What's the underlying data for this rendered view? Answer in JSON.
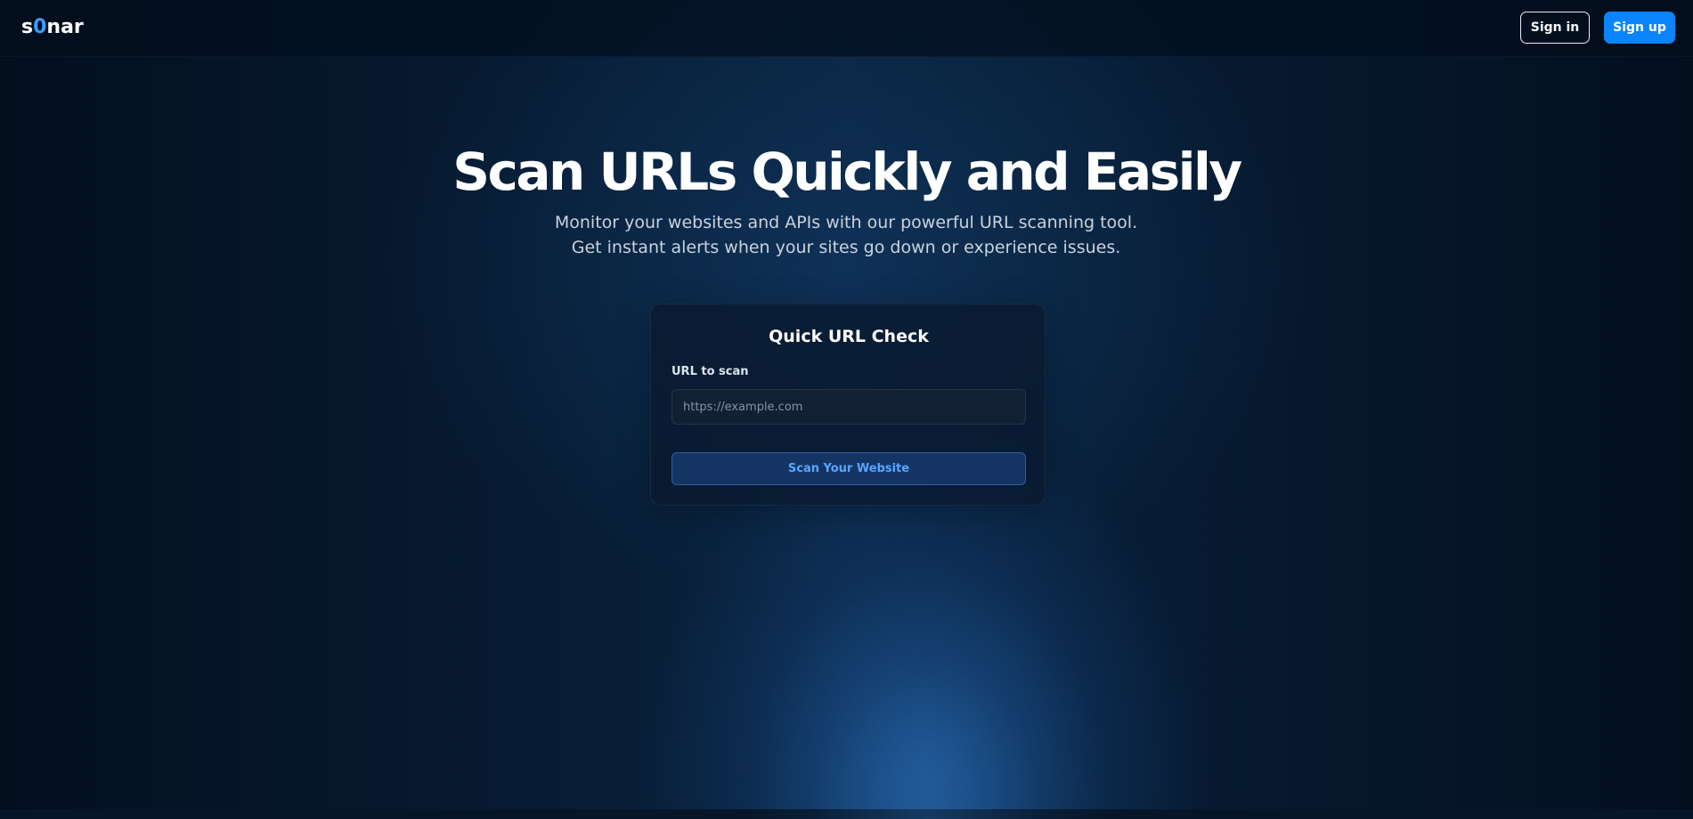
{
  "header": {
    "logo_prefix": "s",
    "logo_accent": "0",
    "logo_suffix": "nar",
    "signin_label": "Sign in",
    "signup_label": "Sign up"
  },
  "hero": {
    "title": "Scan URLs Quickly and Easily",
    "subtitle": "Monitor your websites and APIs with our powerful URL scanning tool. Get instant alerts when your sites go down or experience issues."
  },
  "quick_check": {
    "title": "Quick URL Check",
    "field_label": "URL to scan",
    "input_value": "",
    "input_placeholder": "https://example.com",
    "button_label": "Scan Your Website"
  },
  "colors": {
    "background": "#061628",
    "accent": "#0a84ff",
    "logo_accent": "#3b9cff",
    "scan_button_bg": "#143564",
    "scan_button_text": "#56a6ff"
  }
}
